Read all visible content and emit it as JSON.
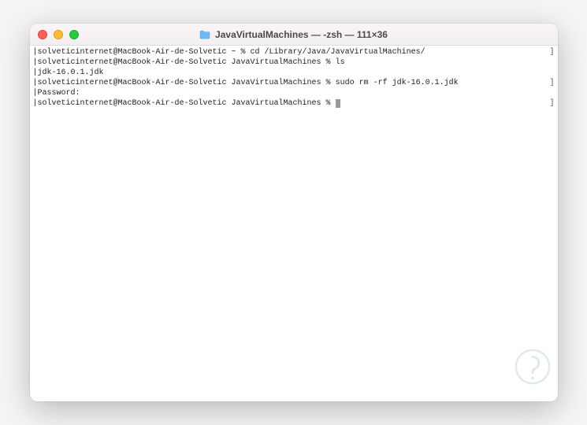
{
  "window": {
    "title": "JavaVirtualMachines — -zsh — 111×36"
  },
  "terminal": {
    "lines": [
      {
        "prompt": "solveticinternet@MacBook-Air-de-Solvetic ~ % ",
        "cmd": "cd /Library/Java/JavaVirtualMachines/",
        "has_rb": true,
        "has_lb": true
      },
      {
        "prompt": "solveticinternet@MacBook-Air-de-Solvetic JavaVirtualMachines % ",
        "cmd": "ls",
        "has_rb": false,
        "has_lb": true
      },
      {
        "prompt": "",
        "cmd": "jdk-16.0.1.jdk",
        "has_rb": false,
        "has_lb": true
      },
      {
        "prompt": "solveticinternet@MacBook-Air-de-Solvetic JavaVirtualMachines % ",
        "cmd": "sudo rm -rf jdk-16.0.1.jdk",
        "has_rb": true,
        "has_lb": true
      },
      {
        "prompt": "",
        "cmd": "Password:",
        "has_rb": false,
        "has_lb": true
      },
      {
        "prompt": "solveticinternet@MacBook-Air-de-Solvetic JavaVirtualMachines % ",
        "cmd": "",
        "has_rb": true,
        "has_lb": true,
        "cursor": true
      }
    ]
  }
}
